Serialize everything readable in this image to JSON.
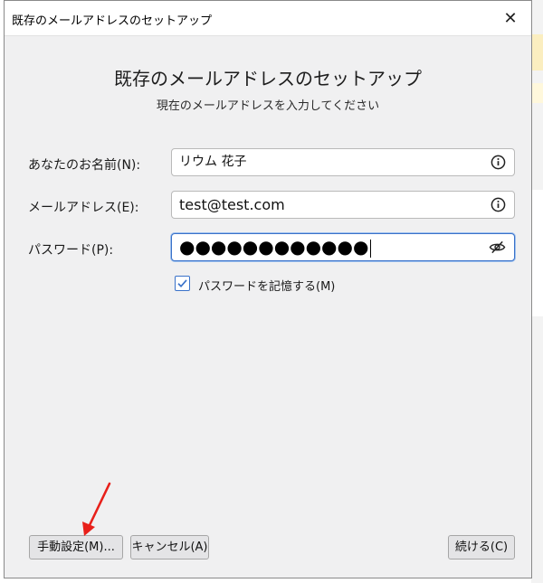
{
  "window": {
    "title": "既存のメールアドレスのセットアップ",
    "close_symbol": "✕"
  },
  "header": {
    "title": "既存のメールアドレスのセットアップ",
    "subtitle": "現在のメールアドレスを入力してください"
  },
  "form": {
    "name_label": "あなたのお名前(N):",
    "name_value": "リウム 花子",
    "email_label": "メールアドレス(E):",
    "email_value": "test@test.com",
    "password_label": "パスワード(P):",
    "password_value": "●●●●●●●●●●●●",
    "remember_label": "パスワードを記憶する(M)",
    "remember_checked": true
  },
  "buttons": {
    "manual": "手動設定(M)...",
    "cancel": "キャンセル(A)",
    "continue": "続ける(C)"
  },
  "icons": {
    "info": "info-icon",
    "eye_slash": "eye-slash-icon",
    "check": "checkmark-icon",
    "close": "close-icon"
  },
  "colors": {
    "accent": "#3a72c9",
    "annotation_arrow": "#e8201a"
  }
}
